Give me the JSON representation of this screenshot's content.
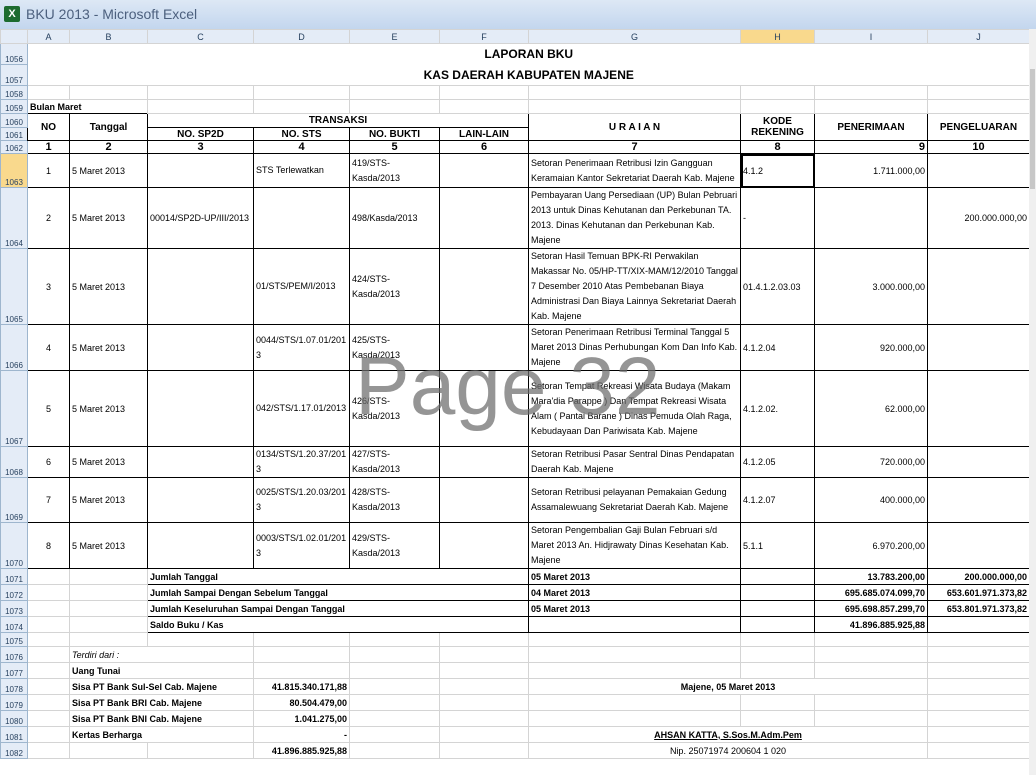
{
  "window": {
    "title": "BKU 2013 - Microsoft Excel",
    "app_icon": "excel-icon"
  },
  "columns": [
    "A",
    "B",
    "C",
    "D",
    "E",
    "F",
    "G",
    "H",
    "I",
    "J"
  ],
  "selected_column": "H",
  "rows": {
    "r1056": "1056",
    "r1057": "1057",
    "r1058": "1058",
    "r1059": "1059",
    "r1060": "1060",
    "r1061": "1061",
    "r1062": "1062",
    "r1063": "1063",
    "r1064": "1064",
    "r1065": "1065",
    "r1066": "1066",
    "r1067": "1067",
    "r1068": "1068",
    "r1069": "1069",
    "r1070": "1070",
    "r1071": "1071",
    "r1072": "1072",
    "r1073": "1073",
    "r1074": "1074",
    "r1075": "1075",
    "r1076": "1076",
    "r1077": "1077",
    "r1078": "1078",
    "r1079": "1079",
    "r1080": "1080",
    "r1081": "1081",
    "r1082": "1082"
  },
  "report": {
    "title1": "LAPORAN BKU",
    "title2": "KAS DAERAH KABUPATEN MAJENE",
    "period": "Bulan Maret"
  },
  "headers": {
    "no": "NO",
    "tanggal": "Tanggal",
    "transaksi": "TRANSAKSI",
    "sp2d": "NO. SP2D",
    "sts": "NO. STS",
    "bukti": "NO. BUKTI",
    "lain": "LAIN-LAIN",
    "uraian": "U R A I A N",
    "kode": "KODE REKENING",
    "penerimaan": "PENERIMAAN",
    "pengeluaran": "PENGELUARAN",
    "nums": [
      "1",
      "2",
      "3",
      "4",
      "5",
      "6",
      "7",
      "8",
      "9",
      "10"
    ]
  },
  "entries": [
    {
      "no": "1",
      "tanggal": "5 Maret 2013",
      "sp2d": "",
      "sts": "STS Terlewatkan",
      "bukti": "419/STS-Kasda/2013",
      "lain": "",
      "uraian": "Setoran Penerimaan Retribusi Izin Gangguan Keramaian Kantor Sekretariat Daerah Kab. Majene",
      "kode": "4.1.2",
      "penerimaan": "1.711.000,00",
      "pengeluaran": ""
    },
    {
      "no": "2",
      "tanggal": "5 Maret 2013",
      "sp2d": "00014/SP2D-UP/III/2013",
      "sts": "",
      "bukti": "498/Kasda/2013",
      "lain": "",
      "uraian": "Pembayaran Uang Persediaan (UP) Bulan Pebruari 2013 untuk Dinas Kehutanan dan Perkebunan TA. 2013. Dinas Kehutanan dan Perkebunan Kab. Majene",
      "kode": "-",
      "penerimaan": "",
      "pengeluaran": "200.000.000,00"
    },
    {
      "no": "3",
      "tanggal": "5 Maret 2013",
      "sp2d": "",
      "sts": "01/STS/PEM/I/2013",
      "bukti": "424/STS-Kasda/2013",
      "lain": "",
      "uraian": "Setoran Hasil Temuan BPK-RI Perwakilan Makassar No. 05/HP-TT/XIX-MAM/12/2010 Tanggal 7 Desember 2010 Atas Pembebanan Biaya Administrasi Dan Biaya Lainnya Sekretariat Daerah Kab. Majene",
      "kode": "01.4.1.2.03.03",
      "penerimaan": "3.000.000,00",
      "pengeluaran": ""
    },
    {
      "no": "4",
      "tanggal": "5 Maret 2013",
      "sp2d": "",
      "sts": "0044/STS/1.07.01/2013",
      "bukti": "425/STS-Kasda/2013",
      "lain": "",
      "uraian": "Setoran Penerimaan Retribusi Terminal Tanggal 5 Maret 2013 Dinas Perhubungan Kom Dan Info Kab. Majene",
      "kode": "4.1.2.04",
      "penerimaan": "920.000,00",
      "pengeluaran": ""
    },
    {
      "no": "5",
      "tanggal": "5 Maret 2013",
      "sp2d": "",
      "sts": "042/STS/1.17.01/2013",
      "bukti": "426/STS-Kasda/2013",
      "lain": "",
      "uraian": "Setoran Tempat Rekreasi Wisata Budaya (Makam Mara'dia Parappe ) Dan Tempat Rekreasi Wisata Alam ( Pantai Barane ) Dinas Pemuda Olah Raga, Kebudayaan Dan Pariwisata Kab. Majene",
      "kode": "4.1.2.02.",
      "penerimaan": "62.000,00",
      "pengeluaran": ""
    },
    {
      "no": "6",
      "tanggal": "5 Maret 2013",
      "sp2d": "",
      "sts": "0134/STS/1.20.37/2013",
      "bukti": "427/STS-Kasda/2013",
      "lain": "",
      "uraian": "Setoran Retribusi Pasar Sentral Dinas Pendapatan Daerah Kab. Majene",
      "kode": "4.1.2.05",
      "penerimaan": "720.000,00",
      "pengeluaran": ""
    },
    {
      "no": "7",
      "tanggal": "5 Maret 2013",
      "sp2d": "",
      "sts": "0025/STS/1.20.03/2013",
      "bukti": "428/STS-Kasda/2013",
      "lain": "",
      "uraian": "Setoran Retribusi pelayanan Pemakaian Gedung Assamalewuang Sekretariat Daerah Kab. Majene",
      "kode": "4.1.2.07",
      "penerimaan": "400.000,00",
      "pengeluaran": ""
    },
    {
      "no": "8",
      "tanggal": "5 Maret 2013",
      "sp2d": "",
      "sts": "0003/STS/1.02.01/2013",
      "bukti": "429/STS-Kasda/2013",
      "lain": "",
      "uraian": "Setoran Pengembalian Gaji Bulan Februari s/d Maret 2013 An. Hidjrawaty Dinas Kesehatan Kab. Majene",
      "kode": "5.1.1",
      "penerimaan": "6.970.200,00",
      "pengeluaran": ""
    }
  ],
  "totals": [
    {
      "label": "Jumlah Tanggal",
      "date": "05 Maret 2013",
      "penerimaan": "13.783.200,00",
      "pengeluaran": "200.000.000,00"
    },
    {
      "label": "Jumlah Sampai Dengan Sebelum Tanggal",
      "date": "04 Maret 2013",
      "penerimaan": "695.685.074.099,70",
      "pengeluaran": "653.601.971.373,82"
    },
    {
      "label": "Jumlah Keseluruhan Sampai Dengan Tanggal",
      "date": "05 Maret 2013",
      "penerimaan": "695.698.857.299,70",
      "pengeluaran": "653.801.971.373,82"
    },
    {
      "label": "Saldo Buku / Kas",
      "date": "",
      "penerimaan": "41.896.885.925,88",
      "pengeluaran": ""
    }
  ],
  "footer": {
    "terdiri": "Terdiri dari :",
    "uang_tunai": "Uang Tunai",
    "items": [
      {
        "label": "Sisa PT Bank Sul-Sel Cab. Majene",
        "value": "41.815.340.171,88"
      },
      {
        "label": "Sisa PT Bank BRI Cab. Majene",
        "value": "80.504.479,00"
      },
      {
        "label": "Sisa PT Bank BNI Cab. Majene",
        "value": "1.041.275,00"
      },
      {
        "label": "Kertas Berharga",
        "value": "-"
      }
    ],
    "total": "41.896.885.925,88",
    "place_date": "Majene, 05 Maret 2013",
    "signer": "AHSAN KATTA, S.Sos.M.Adm.Pem",
    "nip": "Nip. 25071974 200604 1 020"
  },
  "watermark": "Page 32"
}
